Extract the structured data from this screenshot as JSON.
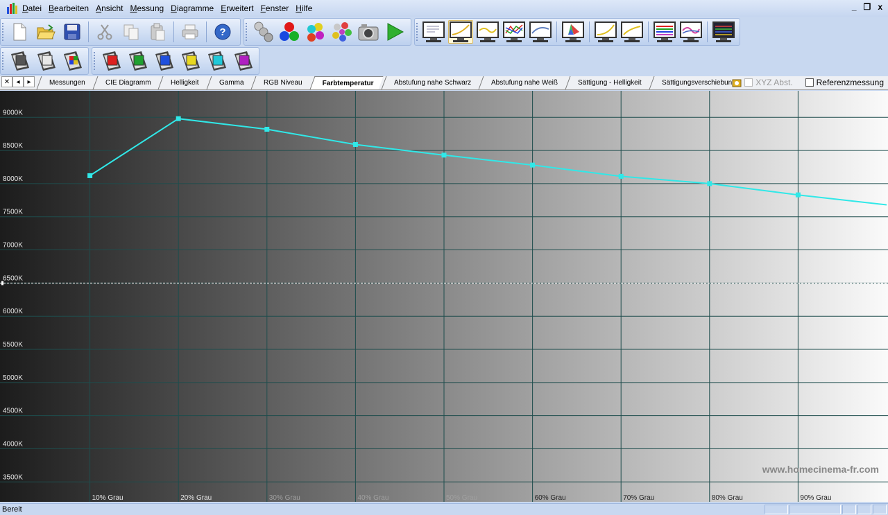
{
  "menu": [
    "Datei",
    "Bearbeiten",
    "Ansicht",
    "Messung",
    "Diagramme",
    "Erweitert",
    "Fenster",
    "Hilfe"
  ],
  "window_controls": [
    "_",
    "❐",
    "x"
  ],
  "toolbar1": {
    "file": [
      "new-icon",
      "open-icon",
      "save-icon"
    ],
    "edit": [
      "cut-icon",
      "copy-icon",
      "paste-icon"
    ],
    "other": [
      "print-icon",
      "help-icon"
    ],
    "measure": [
      "probe-icon",
      "rgb-balls-icon",
      "color-balls-icon",
      "multi-balls-icon",
      "camera-icon",
      "play-icon"
    ],
    "charts": [
      "monitor-doc-icon",
      "monitor-curve-icon",
      "monitor-curve-yellow-icon",
      "monitor-rgb-curves-icon",
      "monitor-curve-2-icon",
      "monitor-cie-icon",
      "monitor-gamma-icon",
      "monitor-gamma-2-icon",
      "monitor-rainbow-icon",
      "monitor-pink-icon",
      "monitor-dark-icon"
    ]
  },
  "toolbar2": {
    "film_icons": [
      "film-gray-icon",
      "film-white-icon",
      "film-rgb-icon",
      "film-red-icon",
      "film-green-icon",
      "film-blue-icon",
      "film-yellow-icon",
      "film-cyan-icon",
      "film-magenta-icon"
    ],
    "film_colors": [
      "#555555",
      "#e8e8e8",
      "#4a8a4a",
      "#dd2020",
      "#20a030",
      "#2050dd",
      "#e8d820",
      "#20c8d8",
      "#b020c0"
    ]
  },
  "tabs": [
    "Messungen",
    "CIE Diagramm",
    "Helligkeit",
    "Gamma",
    "RGB Niveau",
    "Farbtemperatur",
    "Abstufung nahe Schwarz",
    "Abstufung nahe Weiß",
    "Sättigung - Helligkeit",
    "Sättigungsverschiebung"
  ],
  "active_tab": "Farbtemperatur",
  "tab_options": {
    "xyz_label": "XYZ Abst.",
    "reference_label": "Referenzmessung"
  },
  "chart_data": {
    "type": "line",
    "y_ticks": [
      "9000K",
      "8500K",
      "8000K",
      "7500K",
      "7000K",
      "6500K",
      "6000K",
      "5500K",
      "5000K",
      "4500K",
      "4000K",
      "3500K"
    ],
    "x_ticks": [
      "10% Grau",
      "20% Grau",
      "30% Grau",
      "40% Grau",
      "50% Grau",
      "60% Grau",
      "70% Grau",
      "80% Grau",
      "90% Grau"
    ],
    "x": [
      10,
      20,
      30,
      40,
      50,
      60,
      70,
      80,
      90,
      100
    ],
    "values": [
      8120,
      8980,
      8820,
      8590,
      8430,
      8280,
      8110,
      8000,
      7830,
      7680
    ],
    "reference": 6500,
    "ylim": [
      3200,
      9400
    ],
    "xlim": [
      0,
      100
    ],
    "line_color": "#30e8e8",
    "grid": true,
    "watermark": "www.homecinema-fr.com"
  },
  "status": {
    "text": "Bereit"
  }
}
